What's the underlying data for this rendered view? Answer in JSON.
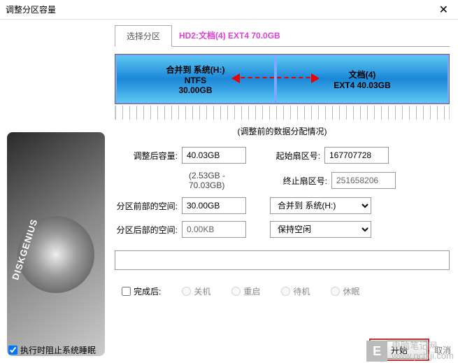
{
  "window": {
    "title": "调整分区容量"
  },
  "tabs": {
    "select_label": "选择分区",
    "selected": "HD2:文档(4) EXT4 70.0GB"
  },
  "partitions": {
    "a": {
      "name": "合并到 系统(H:)",
      "fs": "NTFS",
      "size": "30.00GB"
    },
    "b": {
      "name": "文档(4)",
      "fs": "EXT4 40.03GB"
    }
  },
  "caption": "(调整前的数据分配情况)",
  "fields": {
    "after_size_label": "调整后容量:",
    "after_size_value": "40.03GB",
    "after_size_range": "(2.53GB - 70.03GB)",
    "start_sector_label": "起始扇区号:",
    "start_sector_value": "167707728",
    "end_sector_label": "终止扇区号:",
    "end_sector_value": "251658206",
    "before_space_label": "分区前部的空间:",
    "before_space_value": "30.00GB",
    "before_space_target": "合并到 系统(H:)",
    "after_space_label": "分区后部的空间:",
    "after_space_value": "0.00KB",
    "after_space_target": "保持空闲"
  },
  "after_action": {
    "label": "完成后:",
    "opts": {
      "shutdown": "关机",
      "reboot": "重启",
      "standby": "待机",
      "hibernate": "休眠"
    }
  },
  "bottom": {
    "prevent_sleep": "执行时阻止系统睡眠",
    "start": "开始",
    "cancel": "取消"
  },
  "sidebar_logo": "DISKGENIUS",
  "watermark": {
    "logo": "E",
    "line1": "电脑笔记网",
    "line2": "www.pcbiji.com"
  }
}
